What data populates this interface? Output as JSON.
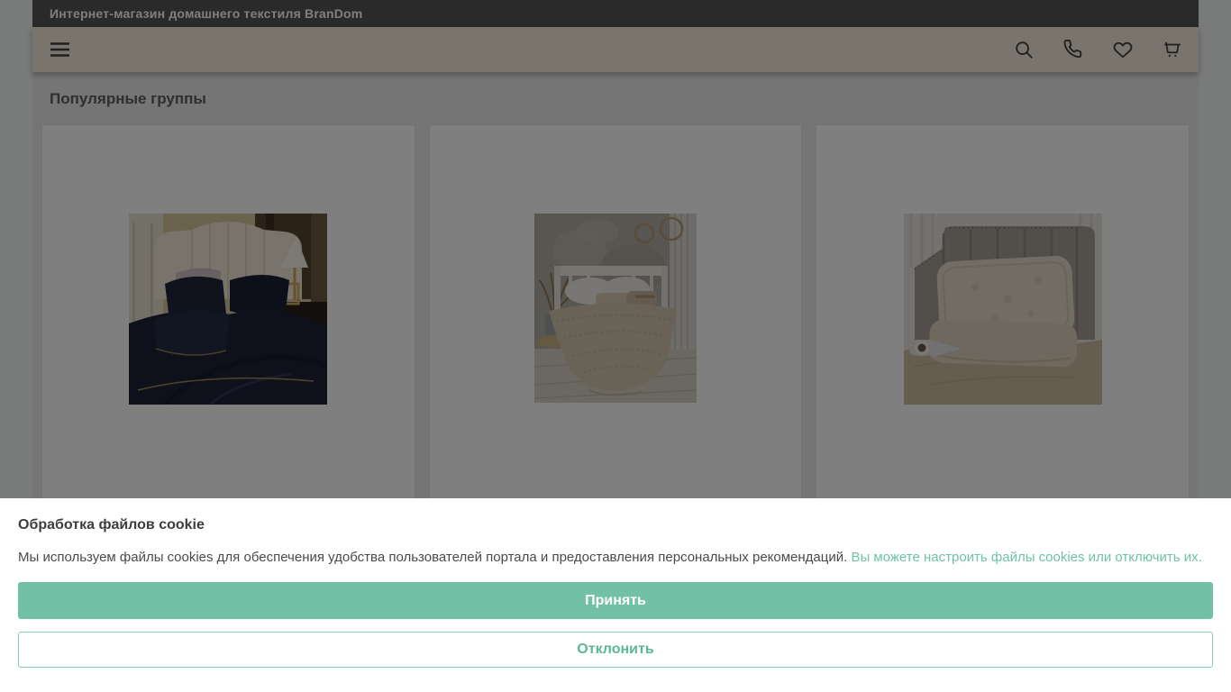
{
  "topbar": {
    "title": "Интернет-магазин домашнего текстиля BranDom"
  },
  "toolbar": {
    "menu_icon": "hamburger-icon",
    "action_icons": [
      "search-icon",
      "phone-icon",
      "heart-icon",
      "cart-icon"
    ]
  },
  "content": {
    "section_title": "Популярные группы",
    "cards": [
      {
        "image": "dark-navy-bedding-photo"
      },
      {
        "image": "beige-bedroom-bed-photo"
      },
      {
        "image": "beige-pillows-photo"
      }
    ]
  },
  "cookie_banner": {
    "title": "Обработка файлов cookie",
    "message": "Мы используем файлы cookies для обеспечения удобства пользователей портала и предоставления персональных рекомендаций.",
    "link": "Вы можете настроить файлы cookies или отключить их.",
    "accept_label": "Принять",
    "decline_label": "Отклонить"
  },
  "colors": {
    "accent_green": "#72c1a6",
    "link_green": "#6fc2a5",
    "topbar_bg_dimmed": "#2a2a2a",
    "toolbar_bg_dimmed": "#79746c",
    "overlay": "rgba(0,0,0,0.5)"
  }
}
